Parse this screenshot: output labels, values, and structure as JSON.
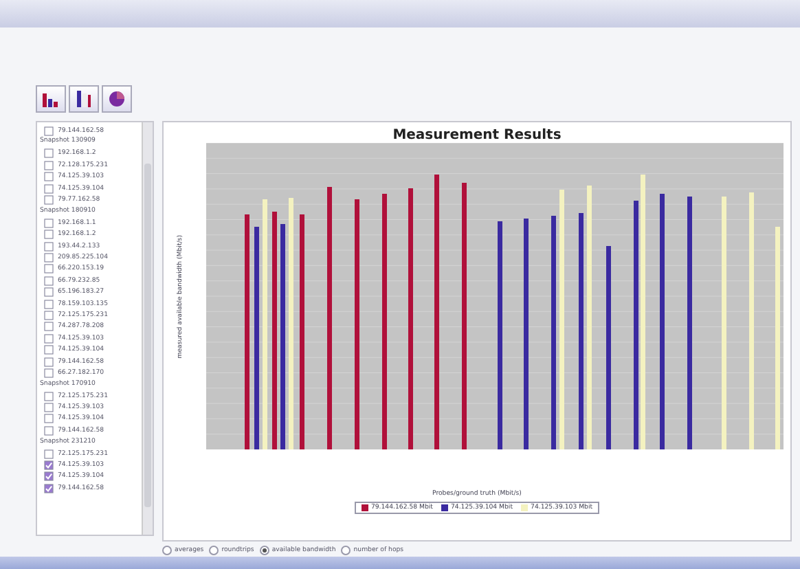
{
  "toolbar": {
    "buttons": [
      {
        "kind": "bar"
      },
      {
        "kind": "column"
      },
      {
        "kind": "pie"
      }
    ]
  },
  "sidebar": {
    "items": [
      {
        "kind": "item",
        "label": "79.144.162.58",
        "checked": false
      },
      {
        "kind": "group",
        "label": "Snapshot 130909",
        "children": [
          {
            "label": "192.168.1.2",
            "checked": false
          },
          {
            "label": "72.128.175.231",
            "checked": false
          },
          {
            "label": "74.125.39.103",
            "checked": false
          },
          {
            "label": "74.125.39.104",
            "checked": false
          },
          {
            "label": "79.77.162.58",
            "checked": false
          }
        ]
      },
      {
        "kind": "group",
        "label": "Snapshot 180910",
        "children": [
          {
            "label": "192.168.1.1",
            "checked": false
          },
          {
            "label": "192.168.1.2",
            "checked": false
          },
          {
            "label": "193.44.2.133",
            "checked": false
          },
          {
            "label": "209.85.225.104",
            "checked": false
          },
          {
            "label": "66.220.153.19",
            "checked": false
          },
          {
            "label": "66.79.232.85",
            "checked": false
          },
          {
            "label": "65.196.183.27",
            "checked": false
          },
          {
            "label": "78.159.103.135",
            "checked": false
          },
          {
            "label": "72.125.175.231",
            "checked": false
          },
          {
            "label": "74.287.78.208",
            "checked": false
          },
          {
            "label": "74.125.39.103",
            "checked": false
          },
          {
            "label": "74.125.39.104",
            "checked": false
          },
          {
            "label": "79.144.162.58",
            "checked": false
          },
          {
            "label": "66.27.182.170",
            "checked": false
          }
        ]
      },
      {
        "kind": "group",
        "label": "Snapshot 170910",
        "children": [
          {
            "label": "72.125.175.231",
            "checked": false
          },
          {
            "label": "74.125.39.103",
            "checked": false
          },
          {
            "label": "74.125.39.104",
            "checked": false
          },
          {
            "label": "79.144.162.58",
            "checked": false
          }
        ]
      },
      {
        "kind": "group",
        "label": "Snapshot 231210",
        "children": [
          {
            "label": "72.125.175.231",
            "checked": false
          },
          {
            "label": "74.125.39.103",
            "checked": true
          },
          {
            "label": "74.125.39.104",
            "checked": true
          },
          {
            "label": "79.144.162.58",
            "checked": true
          }
        ]
      }
    ]
  },
  "chart": {
    "title": "Measurement Results",
    "ylabel": "measured available bandwidth (Mbit/s)",
    "xlabel": "Probes/ground truth (Mbit/s)",
    "legend": [
      {
        "label": "79.144.162.58 Mbit",
        "color": "#b0103a"
      },
      {
        "label": "74.125.39.104 Mbit",
        "color": "#3a2aa0"
      },
      {
        "label": "74.125.39.103 Mbit",
        "color": "#f4f2c0"
      }
    ]
  },
  "options": [
    {
      "label": "averages",
      "selected": false
    },
    {
      "label": "roundtrips",
      "selected": false
    },
    {
      "label": "available bandwidth",
      "selected": true
    },
    {
      "label": "number of hops",
      "selected": false
    }
  ]
}
